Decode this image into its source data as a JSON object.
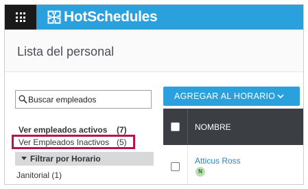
{
  "app": {
    "logo_text": "HotSchedules",
    "grid_icon": "grid-icon",
    "logo_icon": "hotschedules-logo-icon",
    "accent_color": "#2aa1dc",
    "dark_color": "#1a1a1a"
  },
  "page": {
    "title": "Lista del personal"
  },
  "sidebar": {
    "search": {
      "placeholder": "Buscar empleados",
      "value": "",
      "icon": "search-icon"
    },
    "active_label": "Ver empleados activos",
    "active_count": "(7)",
    "inactive_label": "Ver Empleados Inactivos",
    "inactive_count": "(5)",
    "highlight_color": "#b5154b",
    "filter_label": "Filtrar por Horario",
    "filter_icon": "caret-down-icon",
    "schedules": [
      {
        "label": "Janitorial (1)"
      }
    ]
  },
  "main": {
    "add_button_label": "AGREGAR AL HORARIO",
    "add_button_icon": "chevron-down-icon",
    "table": {
      "columns": [
        "NOMBRE"
      ],
      "header_bg": "#3b3f44",
      "rows": [
        {
          "name": "Atticus Ross",
          "badge": "N",
          "badge_color": "#b9e0b0"
        }
      ]
    }
  }
}
